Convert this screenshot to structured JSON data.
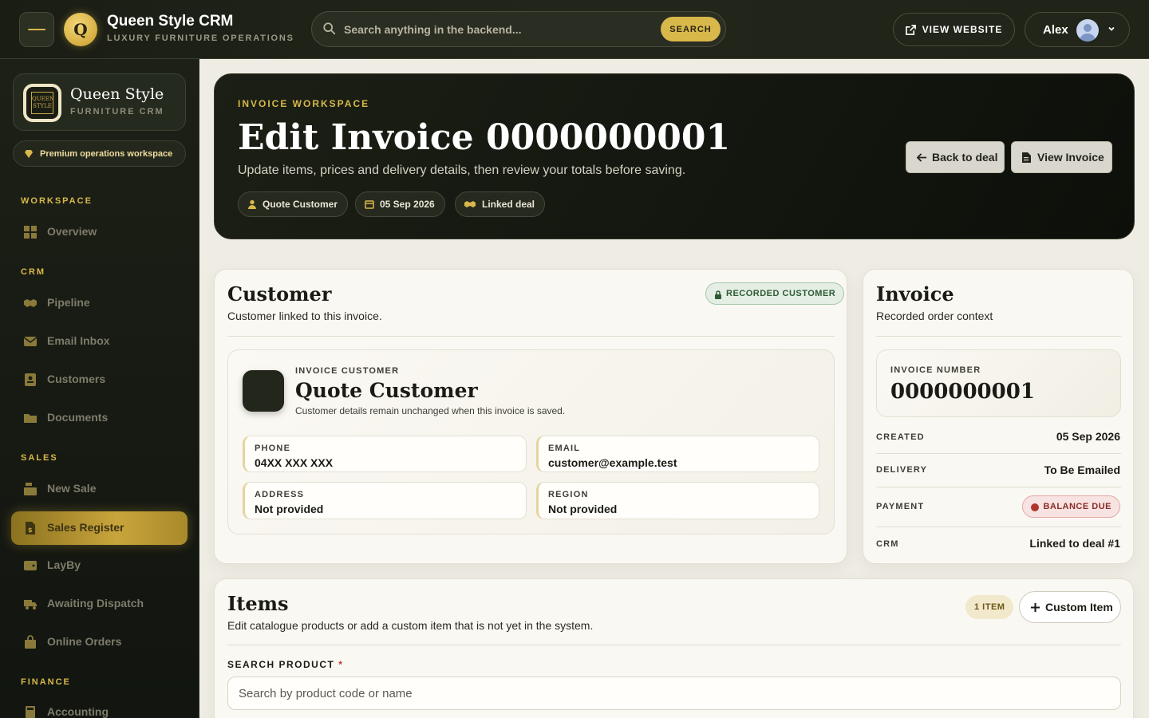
{
  "header": {
    "brand_title": "Queen Style CRM",
    "brand_subtitle": "LUXURY FURNITURE OPERATIONS",
    "logo_letter": "Q",
    "search_placeholder": "Search anything in the backend...",
    "search_button": "SEARCH",
    "view_website": "VIEW WEBSITE",
    "user_name": "Alex"
  },
  "sidebar": {
    "brand_title": "Queen Style",
    "brand_subtitle": "FURNITURE CRM",
    "logo_text": "QUEEN STYLE",
    "workspace_pill": "Premium operations workspace",
    "sections": {
      "workspace": "WORKSPACE",
      "crm": "CRM",
      "sales": "SALES",
      "finance": "FINANCE"
    },
    "items": {
      "overview": "Overview",
      "pipeline": "Pipeline",
      "email_inbox": "Email Inbox",
      "customers": "Customers",
      "documents": "Documents",
      "new_sale": "New Sale",
      "sales_register": "Sales Register",
      "layby": "LayBy",
      "awaiting_dispatch": "Awaiting Dispatch",
      "online_orders": "Online Orders",
      "accounting": "Accounting"
    }
  },
  "hero": {
    "eyebrow": "INVOICE WORKSPACE",
    "title": "Edit Invoice 0000000001",
    "description": "Update items, prices and delivery details, then review your totals before saving.",
    "chips": {
      "customer": "Quote Customer",
      "date": "05 Sep 2026",
      "deal": "Linked deal"
    },
    "back_button": "Back to deal",
    "view_button": "View Invoice"
  },
  "customer_card": {
    "title": "Customer",
    "subtitle": "Customer linked to this invoice.",
    "badge": "RECORDED CUSTOMER",
    "eyebrow": "INVOICE CUSTOMER",
    "name": "Quote Customer",
    "note": "Customer details remain unchanged when this invoice is saved.",
    "fields": {
      "phone_label": "PHONE",
      "phone_value": "04XX XXX XXX",
      "email_label": "EMAIL",
      "email_value": "customer@example.test",
      "address_label": "ADDRESS",
      "address_value": "Not provided",
      "region_label": "REGION",
      "region_value": "Not provided"
    }
  },
  "invoice_card": {
    "title": "Invoice",
    "subtitle": "Recorded order context",
    "number_label": "INVOICE NUMBER",
    "number_value": "0000000001",
    "created_label": "CREATED",
    "created_value": "05 Sep 2026",
    "delivery_label": "DELIVERY",
    "delivery_value": "To Be Emailed",
    "payment_label": "PAYMENT",
    "payment_value": "BALANCE DUE",
    "crm_label": "CRM",
    "crm_value": "Linked to deal #1"
  },
  "items_card": {
    "title": "Items",
    "subtitle": "Edit catalogue products or add a custom item that is not yet in the system.",
    "count_badge": "1 ITEM",
    "custom_button": "Custom Item",
    "search_label": "SEARCH PRODUCT",
    "required_mark": "*",
    "search_placeholder": "Search by product code or name"
  },
  "colors": {
    "gold": "#d8b84a",
    "dark": "#1a1d14",
    "paper": "#faf8f2",
    "success": "#2e5a36",
    "danger": "#8a2b28"
  },
  "icons": [
    "menu-icon",
    "search-icon",
    "external-link-icon",
    "user-avatar",
    "chevron-down-icon",
    "diamond-icon",
    "grid-icon",
    "handshake-icon",
    "envelope-icon",
    "id-card-icon",
    "folder-icon",
    "cash-register-icon",
    "file-invoice-icon",
    "wallet-icon",
    "truck-icon",
    "shopping-bag-icon",
    "calculator-icon",
    "user-icon",
    "calendar-icon",
    "lock-icon",
    "arrow-left-icon",
    "file-icon",
    "plus-icon"
  ]
}
